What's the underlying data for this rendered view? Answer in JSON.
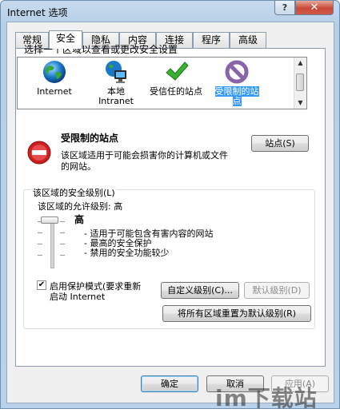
{
  "window": {
    "title": "Internet 选项",
    "help_label": "?",
    "close_label": "✕"
  },
  "tabs": [
    {
      "label": "常规",
      "active": false
    },
    {
      "label": "安全",
      "active": true
    },
    {
      "label": "隐私",
      "active": false
    },
    {
      "label": "内容",
      "active": false
    },
    {
      "label": "连接",
      "active": false
    },
    {
      "label": "程序",
      "active": false
    },
    {
      "label": "高级",
      "active": false
    }
  ],
  "security": {
    "zone_prompt": "选择一个区域以查看或更改安全设置",
    "zones": [
      {
        "label_line1": "Internet",
        "label_line2": "",
        "icon": "globe-icon",
        "selected": false
      },
      {
        "label_line1": "本地",
        "label_line2": "Intranet",
        "icon": "intranet-icon",
        "selected": false
      },
      {
        "label_line1": "受信任的站点",
        "label_line2": "",
        "icon": "checkmark-icon",
        "selected": false
      },
      {
        "label_line1": "受限制的站",
        "label_line2": "点",
        "icon": "restricted-icon",
        "selected": true
      }
    ],
    "zone_title": "受限制的站点",
    "zone_desc_line1": "该区域适用于可能会损害你的计算机或文件",
    "zone_desc_line2": "的网站。",
    "sites_button": "站点(S)",
    "group_label": "该区域的安全级别(L)",
    "allowed_levels": "该区域的允许级别: 高",
    "level_name": "高",
    "bullets": [
      "- 适用于可能包含有害内容的网站",
      "- 最高的安全保护",
      "- 禁用的安全功能较少"
    ],
    "protected_mode_line1": "启用保护模式(要求重新",
    "protected_mode_line2": "启动 Internet",
    "protected_mode_checked": true,
    "custom_level_button": "自定义级别(C)...",
    "default_level_button": "默认级别(D)",
    "reset_all_button": "将所有区域重置为默认级别(R)"
  },
  "footer": {
    "ok_button": "确定",
    "cancel_button": "取消",
    "apply_button": "应用(A)"
  },
  "watermark": {
    "text": "im下载站"
  },
  "colors": {
    "selection": "#3399ff",
    "title_bar": "#b9d1ea",
    "restricted_red": "#cc1f1f"
  }
}
